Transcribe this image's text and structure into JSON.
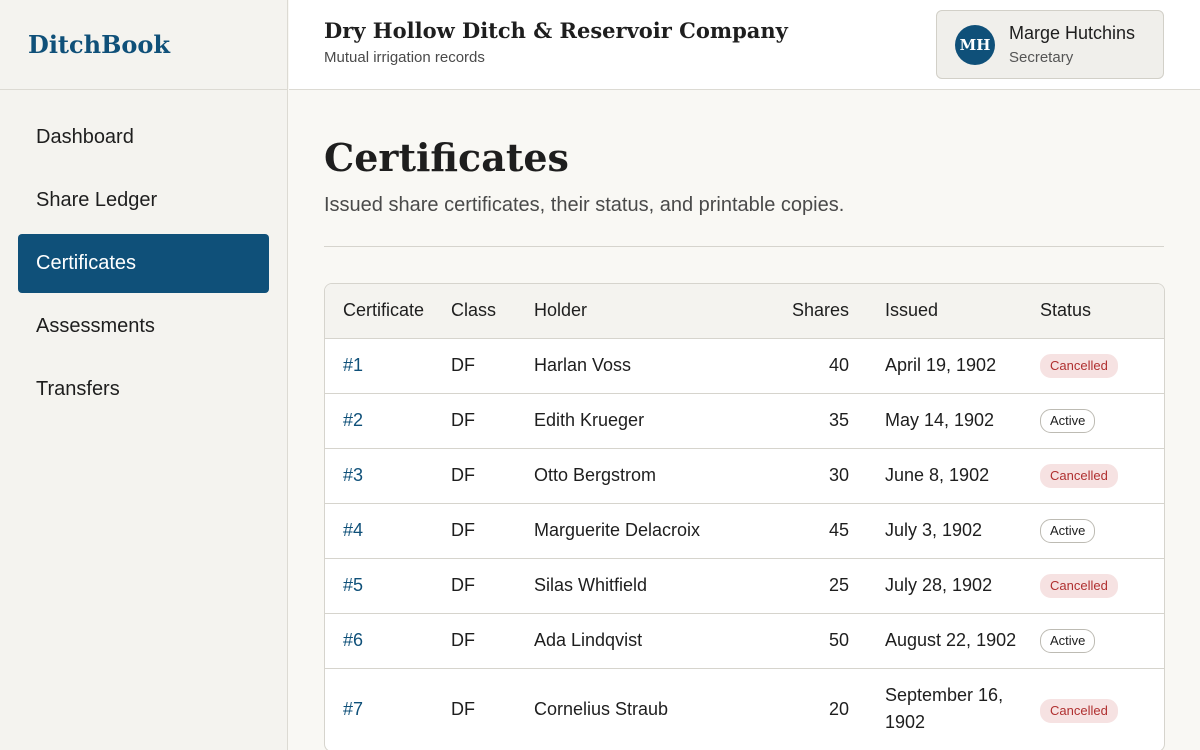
{
  "app": {
    "brand": "DitchBook"
  },
  "header": {
    "org_name": "Dry Hollow Ditch & Reservoir Company",
    "org_sub": "Mutual irrigation records",
    "user": {
      "initials": "MH",
      "name": "Marge Hutchins",
      "role": "Secretary"
    }
  },
  "sidebar": {
    "items": [
      {
        "label": "Dashboard"
      },
      {
        "label": "Share Ledger"
      },
      {
        "label": "Certificates",
        "active": true
      },
      {
        "label": "Assessments"
      },
      {
        "label": "Transfers"
      }
    ]
  },
  "page": {
    "title": "Certificates",
    "subtitle": "Issued share certificates, their status, and printable copies."
  },
  "table": {
    "columns": [
      "Certificate",
      "Class",
      "Holder",
      "Shares",
      "Issued",
      "Status"
    ],
    "rows": [
      {
        "cert": "#1",
        "class": "DF",
        "holder": "Harlan Voss",
        "shares": "40",
        "issued": "April 19, 1902",
        "status": "Cancelled"
      },
      {
        "cert": "#2",
        "class": "DF",
        "holder": "Edith Krueger",
        "shares": "35",
        "issued": "May 14, 1902",
        "status": "Active"
      },
      {
        "cert": "#3",
        "class": "DF",
        "holder": "Otto Bergstrom",
        "shares": "30",
        "issued": "June 8, 1902",
        "status": "Cancelled"
      },
      {
        "cert": "#4",
        "class": "DF",
        "holder": "Marguerite Delacroix",
        "shares": "45",
        "issued": "July 3, 1902",
        "status": "Active"
      },
      {
        "cert": "#5",
        "class": "DF",
        "holder": "Silas Whitfield",
        "shares": "25",
        "issued": "July 28, 1902",
        "status": "Cancelled"
      },
      {
        "cert": "#6",
        "class": "DF",
        "holder": "Ada Lindqvist",
        "shares": "50",
        "issued": "August 22, 1902",
        "status": "Active"
      },
      {
        "cert": "#7",
        "class": "DF",
        "holder": "Cornelius Straub",
        "shares": "20",
        "issued": "September 16, 1902",
        "status": "Cancelled"
      }
    ]
  },
  "colors": {
    "brand": "#0f5079",
    "cancelled_text": "#b03030",
    "cancelled_bg": "#f6e2e2"
  }
}
